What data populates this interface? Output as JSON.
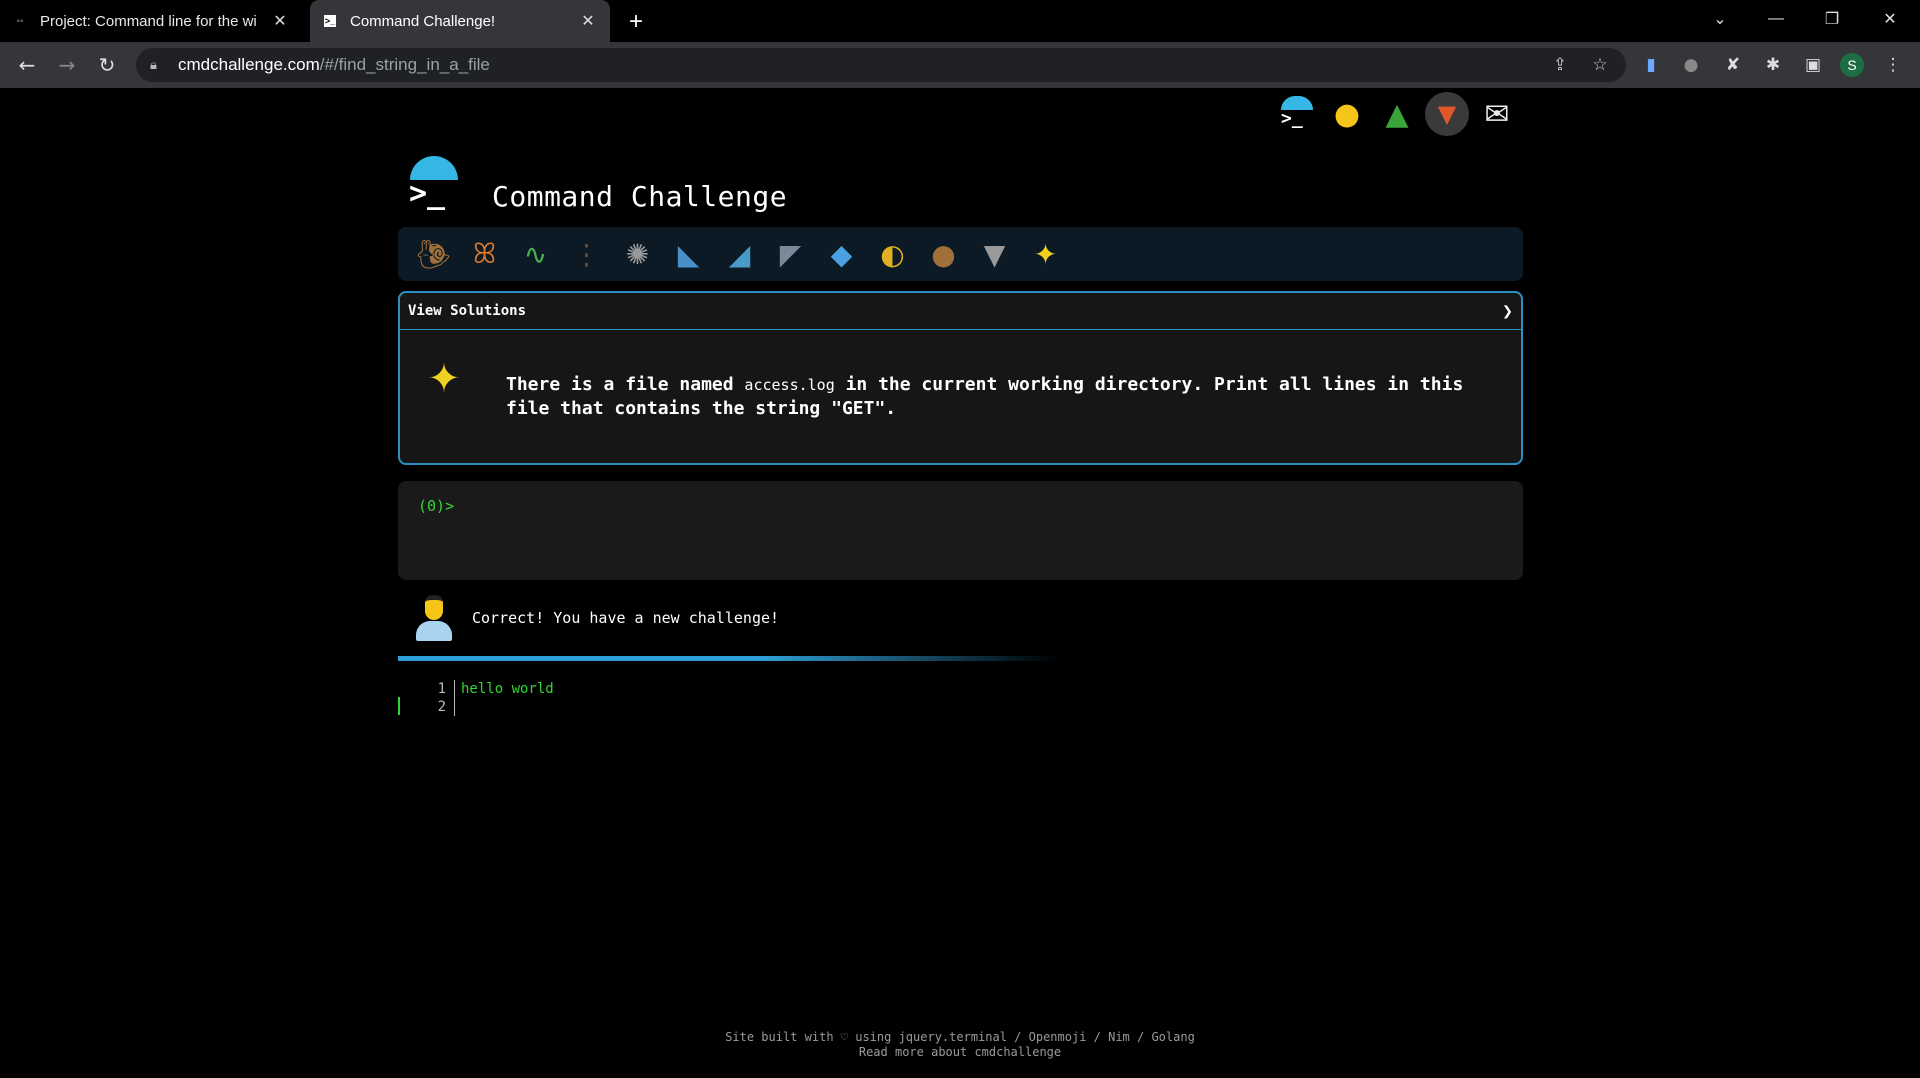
{
  "browser": {
    "tabs": [
      {
        "title": "Project: Command line for the wi",
        "active": false
      },
      {
        "title": "Command Challenge!",
        "active": true
      }
    ],
    "new_tab_label": "+",
    "url_host": "cmdchallenge.com",
    "url_path": "/#/find_string_in_a_file",
    "profile_initial": "S"
  },
  "page": {
    "site_title": "Command Challenge",
    "logo_prompt": ">_",
    "top_icons": [
      "terminal-logo",
      "shushing-face",
      "tree",
      "gitlab",
      "envelope"
    ],
    "animals": [
      "snail",
      "butterfly",
      "caterpillar",
      "ant",
      "spider-web",
      "whale",
      "shark",
      "dolphin",
      "fish",
      "tropical-fish",
      "pufferfish",
      "wolf",
      "bee"
    ],
    "solutions_label": "View Solutions",
    "challenge_pre": "There is a file named ",
    "challenge_code": "access.log",
    "challenge_post": " in the current working directory. Print all lines in this file that contains the string \"GET\".",
    "terminal_prompt": "(0)>",
    "feedback_message": "Correct! You have a new challenge!",
    "progress": 0.55,
    "editor_lines": [
      {
        "num": "1",
        "text": "hello world"
      },
      {
        "num": "2",
        "text": ""
      }
    ],
    "footer_line1": "Site built with ♡ using jquery.terminal / Openmoji / Nim / Golang",
    "footer_line2": "Read more about cmdchallenge"
  },
  "colors": {
    "accent": "#2c8fc2",
    "prompt_green": "#33d633",
    "logo_blue": "#35b8e6"
  }
}
